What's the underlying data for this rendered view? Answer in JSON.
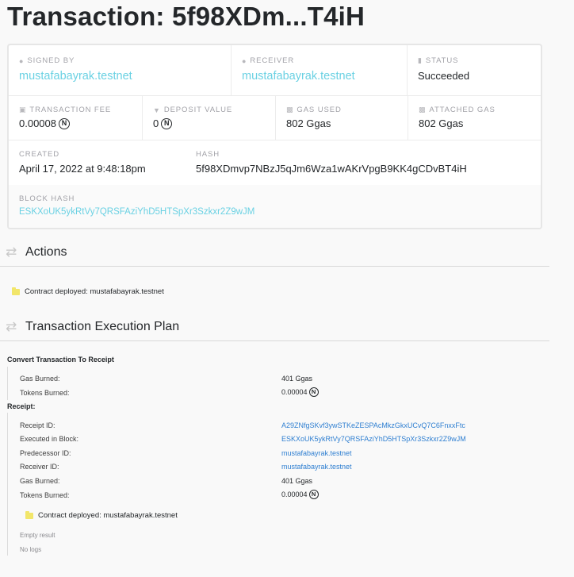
{
  "page_title": "Transaction: 5f98XDm...T4iH",
  "summary": {
    "signed_by_label": "SIGNED BY",
    "signed_by": "mustafabayrak.testnet",
    "receiver_label": "RECEIVER",
    "receiver": "mustafabayrak.testnet",
    "status_label": "STATUS",
    "status": "Succeeded",
    "fee_label": "TRANSACTION FEE",
    "fee": "0.00008",
    "deposit_label": "DEPOSIT VALUE",
    "deposit": "0",
    "gas_used_label": "GAS USED",
    "gas_used": "802 Ggas",
    "attached_gas_label": "ATTACHED GAS",
    "attached_gas": "802 Ggas",
    "created_label": "CREATED",
    "created": "April 17, 2022 at 9:48:18pm",
    "hash_label": "HASH",
    "hash": "5f98XDmvp7NBzJ5qJm6Wza1wAKrVpgB9KK4gCDvBT4iH",
    "block_hash_label": "BLOCK HASH",
    "block_hash": "ESKXoUK5ykRtVy7QRSFAziYhD5HTSpXr3Szkxr2Z9wJM",
    "near_symbol": "N"
  },
  "actions": {
    "heading": "Actions",
    "items": [
      "Contract deployed: mustafabayrak.testnet"
    ]
  },
  "plan": {
    "heading": "Transaction Execution Plan",
    "convert_title": "Convert Transaction To Receipt",
    "convert_rows": [
      {
        "k": "Gas Burned:",
        "v": "401 Ggas"
      },
      {
        "k": "Tokens Burned:",
        "v": "0.00004"
      }
    ],
    "receipt_title": "Receipt:",
    "receipt_rows": [
      {
        "k": "Receipt ID:",
        "v": "A29ZNfgSKvf3ywSTKeZESPAcMkzGkxUCvQ7C6FnxxFtc"
      },
      {
        "k": "Executed in Block:",
        "v": "ESKXoUK5ykRtVy7QRSFAziYhD5HTSpXr3Szkxr2Z9wJM"
      },
      {
        "k": "Predecessor ID:",
        "v": "mustafabayrak.testnet"
      },
      {
        "k": "Receiver ID:",
        "v": "mustafabayrak.testnet"
      },
      {
        "k": "Gas Burned:",
        "v": "401 Ggas"
      },
      {
        "k": "Tokens Burned:",
        "v": "0.00004"
      }
    ],
    "receipt_action": "Contract deployed: mustafabayrak.testnet",
    "empty_result": "Empty result",
    "no_logs": "No logs"
  },
  "colors": {
    "link_accent": "#6ad1e3",
    "link_blue": "#2f7fd1",
    "folder_yellow": "#f2e66a"
  },
  "icons": [
    "user-icon",
    "user-icon",
    "status-icon",
    "fee-icon",
    "deposit-icon",
    "gas-icon",
    "gas-icon",
    "transfer-arrows-icon",
    "folder-icon"
  ]
}
